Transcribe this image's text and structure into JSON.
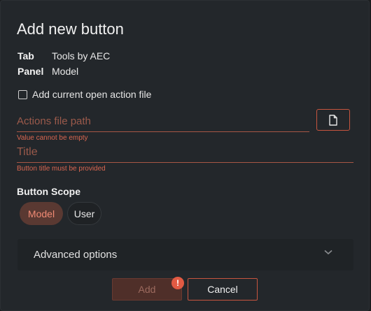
{
  "dialog": {
    "title": "Add new button"
  },
  "meta": {
    "tab_key": "Tab",
    "tab_value": "Tools by AEC",
    "panel_key": "Panel",
    "panel_value": "Model"
  },
  "checkbox": {
    "label": "Add current open action file",
    "checked": false
  },
  "actions_path": {
    "placeholder": "Actions file path",
    "error": "Value cannot be empty"
  },
  "file_button": {
    "icon": "file-icon"
  },
  "title_field": {
    "placeholder": "Title",
    "error": "Button title must be provided"
  },
  "scope": {
    "heading": "Button Scope",
    "options": [
      "Model",
      "User"
    ],
    "selected": "Model"
  },
  "advanced": {
    "label": "Advanced options",
    "icon": "chevron-down-icon"
  },
  "footer": {
    "add_label": "Add",
    "add_badge": "!",
    "cancel_label": "Cancel"
  },
  "colors": {
    "accent": "#c7553f",
    "error": "#d86650",
    "background": "#23272b"
  }
}
